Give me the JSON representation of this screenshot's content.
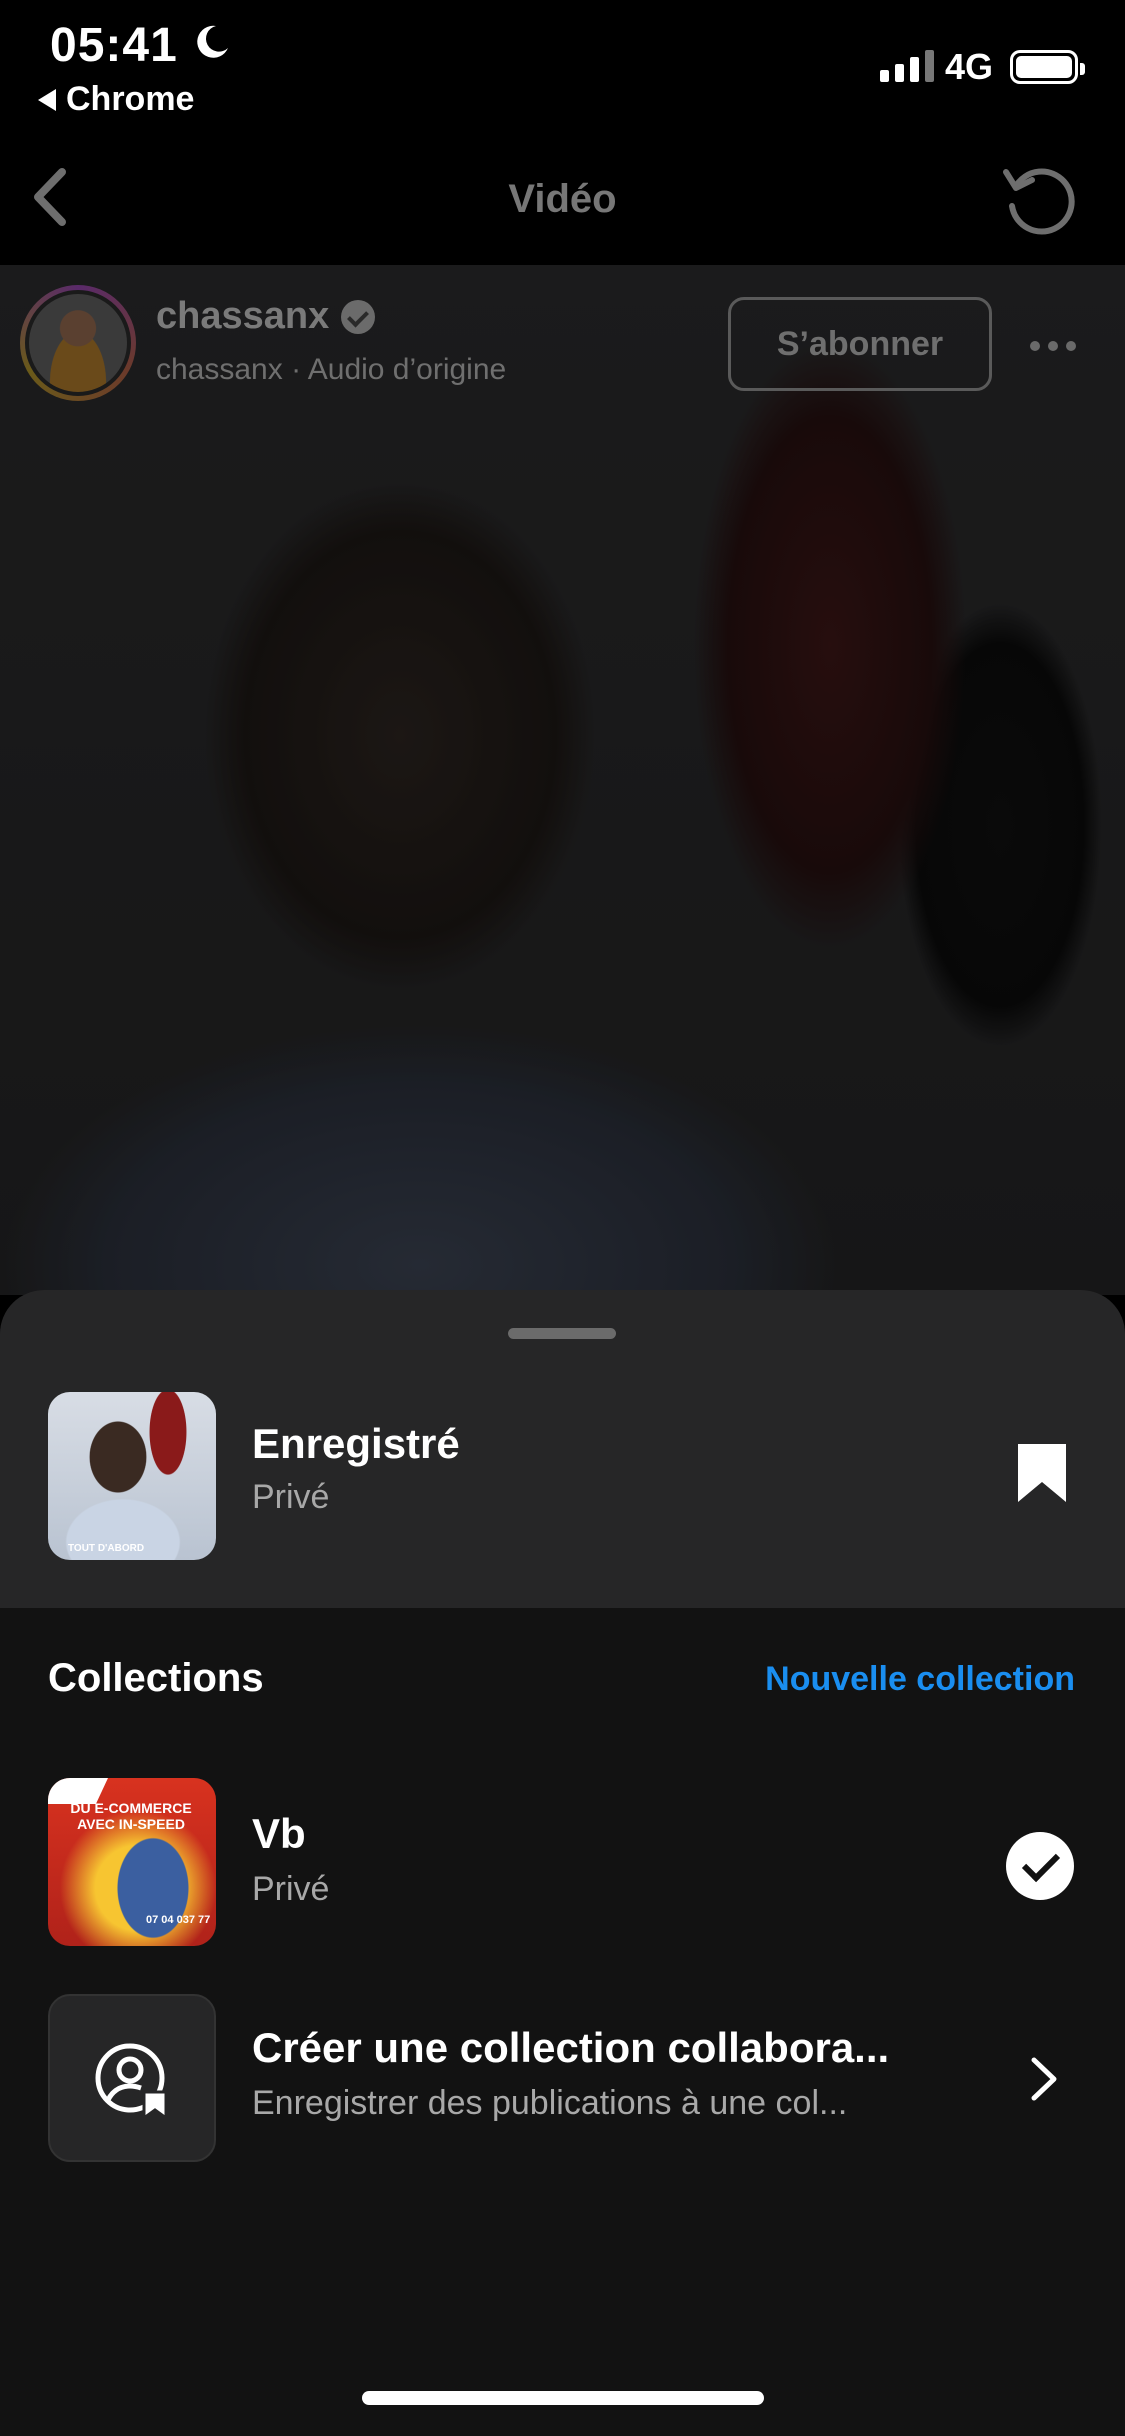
{
  "status_bar": {
    "time": "05:41",
    "back_app": "Chrome",
    "network": "4G"
  },
  "nav": {
    "title": "Vidéo"
  },
  "post": {
    "username": "chassanx",
    "subtitle": "chassanx · Audio d’origine",
    "follow_label": "S’abonner"
  },
  "sheet": {
    "saved": {
      "title": "Enregistré",
      "privacy": "Privé",
      "thumb_caption": "TOUT D'ABORD"
    },
    "collections_title": "Collections",
    "new_collection_label": "Nouvelle collection",
    "collections": [
      {
        "title": "Vb",
        "privacy": "Privé",
        "thumb_text": "DU E-COMMERCE AVEC IN-SPEED",
        "thumb_phone": "07 04 037 77",
        "selected": true
      }
    ],
    "collab": {
      "title": "Créer une collection collabora...",
      "subtitle": "Enregistrer des publications à une col..."
    }
  },
  "colors": {
    "accent": "#1a8ef0",
    "sheet_bg": "#121212",
    "saved_bg": "#262627"
  }
}
